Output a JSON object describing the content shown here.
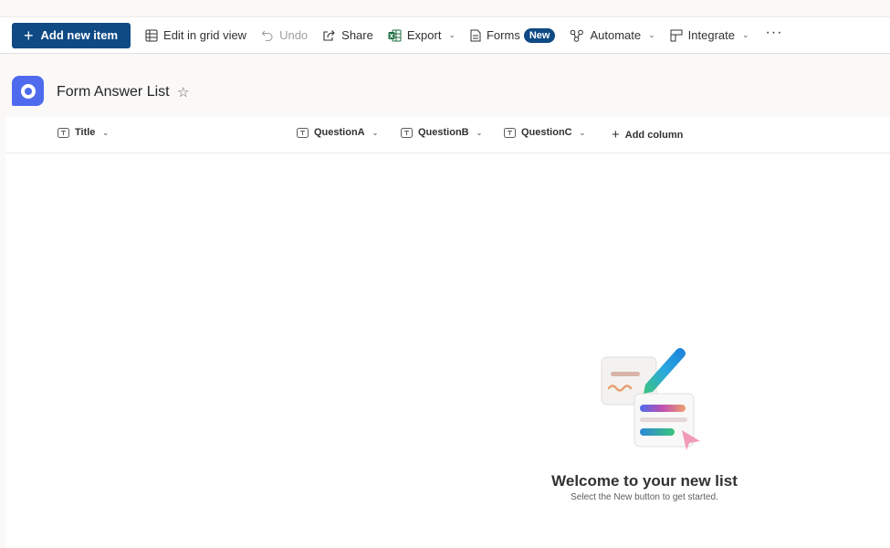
{
  "toolbar": {
    "add_label": "Add new item",
    "edit_grid_label": "Edit in grid view",
    "undo_label": "Undo",
    "share_label": "Share",
    "export_label": "Export",
    "forms_label": "Forms",
    "forms_badge": "New",
    "automate_label": "Automate",
    "integrate_label": "Integrate",
    "more_label": "···"
  },
  "header": {
    "title": "Form Answer List",
    "favorite_icon": "☆",
    "list_icon": "list-icon"
  },
  "columns": [
    {
      "label": "Title",
      "icon": "text-column-icon"
    },
    {
      "label": "QuestionA",
      "icon": "text-column-icon"
    },
    {
      "label": "QuestionB",
      "icon": "text-column-icon"
    },
    {
      "label": "QuestionC",
      "icon": "text-column-icon"
    },
    {
      "label": "Add column",
      "icon": "plus-icon"
    }
  ],
  "empty_state": {
    "heading": "Welcome to your new list",
    "subtext": "Select the New button to get started."
  },
  "colors": {
    "primary": "#0f4a85",
    "list_icon": "#4f6bed",
    "background": "#faf9f8"
  }
}
